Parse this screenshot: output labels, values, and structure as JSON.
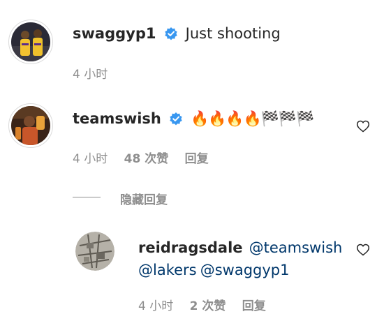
{
  "comments": [
    {
      "username": "swaggyp1",
      "verified": true,
      "text": "Just shooting",
      "time": "4 小时"
    },
    {
      "username": "teamswish",
      "verified": true,
      "emoji": "🔥🔥🔥🔥🏁🏁🏁",
      "time": "4 小时",
      "likes": "48 次赞",
      "reply_label": "回复"
    }
  ],
  "hide_replies_label": "隐藏回复",
  "reply": {
    "username": "reidragsdale",
    "mention1": "@teamswish",
    "mention2": "@lakers",
    "mention3": "@swaggyp1",
    "time": "4 小时",
    "likes": "2 次赞",
    "reply_label": "回复"
  },
  "colors": {
    "text": "#262626",
    "secondary": "#8e8e8e",
    "mention": "#00376b",
    "verified_badge": "#3897f0"
  }
}
